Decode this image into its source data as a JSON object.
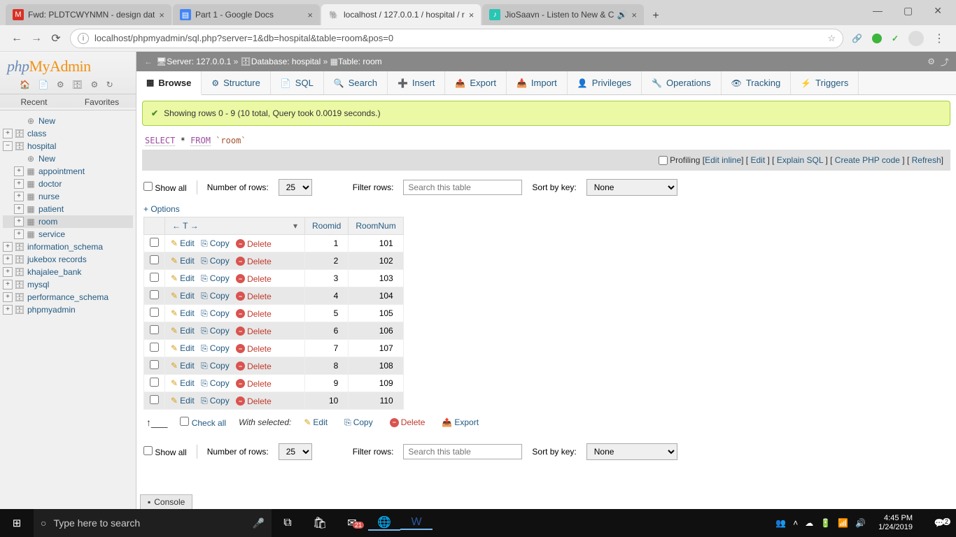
{
  "browser": {
    "tabs": [
      {
        "icon": "M",
        "label": "Fwd: PLDTCWYNMN - design dat",
        "active": false,
        "iconbg": "#d93025",
        "iconcolor": "#fff"
      },
      {
        "icon": "▤",
        "label": "Part 1 - Google Docs",
        "active": false,
        "iconbg": "#4285f4",
        "iconcolor": "#fff"
      },
      {
        "icon": "🐘",
        "label": "localhost / 127.0.0.1 / hospital / r",
        "active": true,
        "iconbg": "transparent",
        "iconcolor": "#f29111"
      },
      {
        "icon": "♪",
        "label": "JioSaavn - Listen to New & C",
        "active": false,
        "audio": true,
        "iconbg": "#2bc5b4",
        "iconcolor": "#fff"
      }
    ],
    "url": "localhost/phpmyadmin/sql.php?server=1&db=hospital&table=room&pos=0"
  },
  "sidebar": {
    "recent": "Recent",
    "favorites": "Favorites",
    "tree": [
      {
        "label": "New",
        "icon": "⊕",
        "indent": 1,
        "exp": ""
      },
      {
        "label": "class",
        "icon": "🗄",
        "indent": 0,
        "exp": "+"
      },
      {
        "label": "hospital",
        "icon": "🗄",
        "indent": 0,
        "exp": "−"
      },
      {
        "label": "New",
        "icon": "⊕",
        "indent": 1,
        "exp": ""
      },
      {
        "label": "appointment",
        "icon": "▦",
        "indent": 1,
        "exp": "+"
      },
      {
        "label": "doctor",
        "icon": "▦",
        "indent": 1,
        "exp": "+"
      },
      {
        "label": "nurse",
        "icon": "▦",
        "indent": 1,
        "exp": "+"
      },
      {
        "label": "patient",
        "icon": "▦",
        "indent": 1,
        "exp": "+"
      },
      {
        "label": "room",
        "icon": "▦",
        "indent": 1,
        "exp": "+",
        "selected": true
      },
      {
        "label": "service",
        "icon": "▦",
        "indent": 1,
        "exp": "+"
      },
      {
        "label": "information_schema",
        "icon": "🗄",
        "indent": 0,
        "exp": "+"
      },
      {
        "label": "jukebox records",
        "icon": "🗄",
        "indent": 0,
        "exp": "+"
      },
      {
        "label": "khajalee_bank",
        "icon": "🗄",
        "indent": 0,
        "exp": "+"
      },
      {
        "label": "mysql",
        "icon": "🗄",
        "indent": 0,
        "exp": "+"
      },
      {
        "label": "performance_schema",
        "icon": "🗄",
        "indent": 0,
        "exp": "+"
      },
      {
        "label": "phpmyadmin",
        "icon": "🗄",
        "indent": 0,
        "exp": "+"
      }
    ]
  },
  "crumb": {
    "server_label": "Server: 127.0.0.1",
    "db_label": "Database: hospital",
    "table_label": "Table: room"
  },
  "tabs": [
    {
      "label": "Browse",
      "icon": "▦",
      "active": true
    },
    {
      "label": "Structure",
      "icon": "⚙"
    },
    {
      "label": "SQL",
      "icon": "📄"
    },
    {
      "label": "Search",
      "icon": "🔍"
    },
    {
      "label": "Insert",
      "icon": "➕"
    },
    {
      "label": "Export",
      "icon": "📤"
    },
    {
      "label": "Import",
      "icon": "📥"
    },
    {
      "label": "Privileges",
      "icon": "👤"
    },
    {
      "label": "Operations",
      "icon": "🔧"
    },
    {
      "label": "Tracking",
      "icon": "👁"
    },
    {
      "label": "Triggers",
      "icon": "⚡"
    }
  ],
  "success": "Showing rows 0 - 9 (10 total, Query took 0.0019 seconds.)",
  "sql": {
    "select": "SELECT",
    "star": "*",
    "from": "FROM",
    "table": "`room`"
  },
  "toolbar": {
    "profiling": "Profiling",
    "edit_inline": "Edit inline",
    "edit": "Edit",
    "explain": "Explain SQL",
    "php": "Create PHP code",
    "refresh": "Refresh"
  },
  "controls": {
    "show_all": "Show all",
    "num_rows": "Number of rows:",
    "num_rows_val": "25",
    "filter": "Filter rows:",
    "search_ph": "Search this table",
    "sort": "Sort by key:",
    "sort_val": "None"
  },
  "options": "+ Options",
  "cols": {
    "roomid": "Roomid",
    "roomnum": "RoomNum"
  },
  "actions": {
    "edit": "Edit",
    "copy": "Copy",
    "delete": "Delete"
  },
  "rows": [
    {
      "id": "1",
      "num": "101"
    },
    {
      "id": "2",
      "num": "102"
    },
    {
      "id": "3",
      "num": "103"
    },
    {
      "id": "4",
      "num": "104"
    },
    {
      "id": "5",
      "num": "105"
    },
    {
      "id": "6",
      "num": "106"
    },
    {
      "id": "7",
      "num": "107"
    },
    {
      "id": "8",
      "num": "108"
    },
    {
      "id": "9",
      "num": "109"
    },
    {
      "id": "10",
      "num": "110"
    }
  ],
  "bulk": {
    "check_all": "Check all",
    "with_selected": "With selected:",
    "edit": "Edit",
    "copy": "Copy",
    "delete": "Delete",
    "export": "Export"
  },
  "console": "Console",
  "taskbar": {
    "search_ph": "Type here to search",
    "time": "4:45 PM",
    "date": "1/24/2019",
    "mail_badge": "21",
    "notif_badge": "2"
  }
}
